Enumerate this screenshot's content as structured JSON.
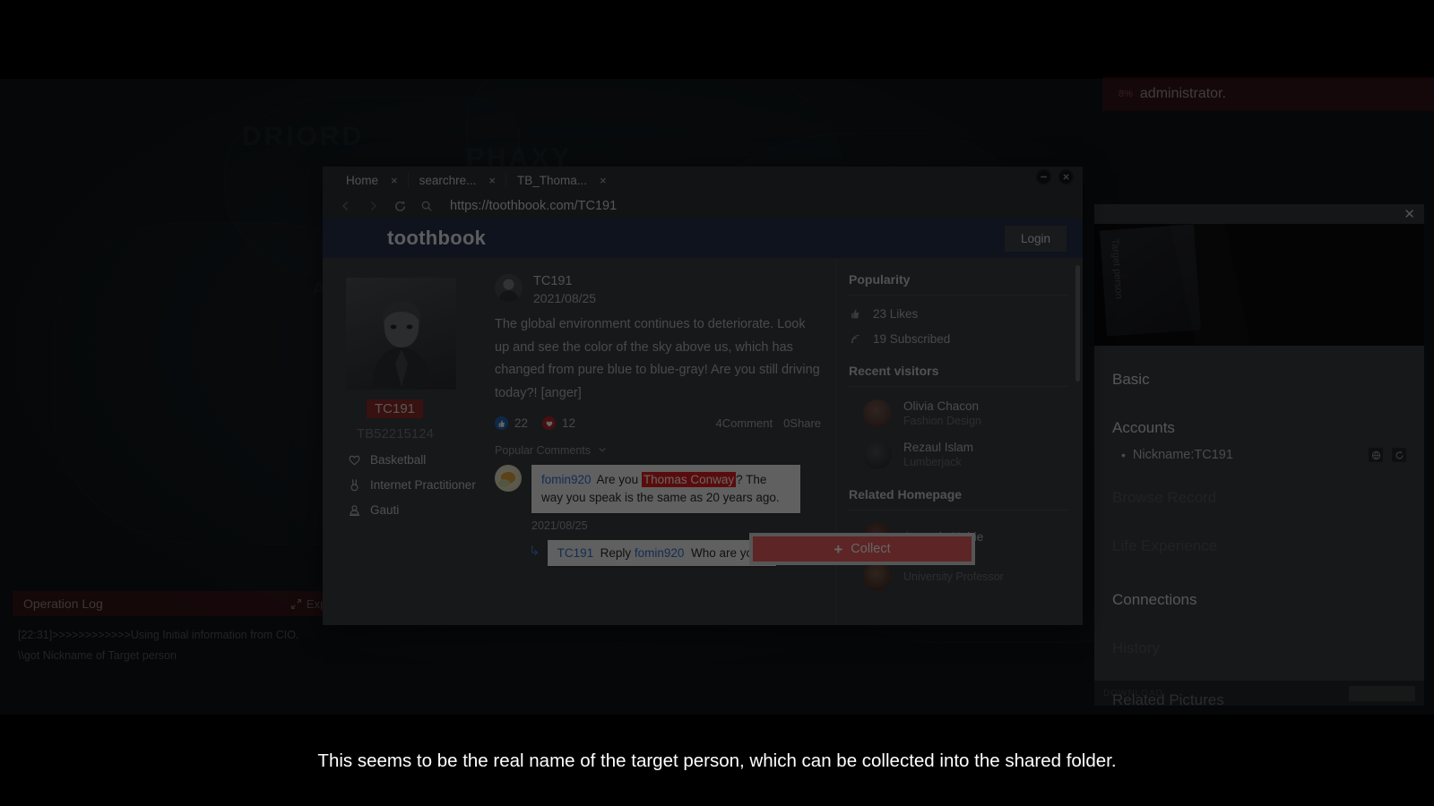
{
  "caption": "This seems to be the real name of the target person, which can be collected into the shared folder.",
  "admin_strip": {
    "percent": "8%",
    "text": "administrator."
  },
  "operation_log": {
    "title": "Operation Log",
    "expand_label": "Expand",
    "lines": [
      "[22:31]>>>>>>>>>>>>Using Initial information from CIO.",
      "\\\\got Nickname of Target person"
    ]
  },
  "background_map": {
    "labels": [
      "DRIORD",
      "PHAXY",
      "A"
    ]
  },
  "browser": {
    "tabs": [
      {
        "label": "Home",
        "close": "×"
      },
      {
        "label": "searchre...",
        "close": "×"
      },
      {
        "label": "TB_Thoma...",
        "close": "×"
      }
    ],
    "window_buttons": [
      "minimize-icon",
      "close-icon"
    ],
    "nav_icons": [
      "back-icon",
      "forward-icon",
      "reload-icon",
      "search-icon"
    ],
    "url": "https://toothbook.com/TC191"
  },
  "site": {
    "brand": "toothbook",
    "login_label": "Login",
    "profile": {
      "badge_name": "TC191",
      "user_id": "TB52215124",
      "meta": [
        {
          "icon": "heart-icon",
          "text": "Basketball"
        },
        {
          "icon": "medal-icon",
          "text": "Internet Practitioner"
        },
        {
          "icon": "location-person-icon",
          "text": "Gauti"
        }
      ]
    },
    "post": {
      "author": "TC191",
      "date": "2021/08/25",
      "text": "The global environment continues to deteriorate. Look up and see the color of the sky above us, which has changed from pure blue to blue-gray! Are you still driving today?! [anger]",
      "like_count": "22",
      "heart_count": "12",
      "comment_count": "4Comment",
      "share_count": "0Share"
    },
    "comments": {
      "section_label": "Popular Comments",
      "sort_icon": "chevron-down-icon",
      "items": [
        {
          "user": "fomin920",
          "text_before": "Are you ",
          "highlight": "Thomas Conway",
          "text_after": "? The way you speak is the same as 20 years ago.",
          "date": "2021/08/25"
        }
      ],
      "reply": {
        "user": "TC191",
        "verb": "Reply",
        "target": "fomin920",
        "text": "Who are you?"
      }
    },
    "right_sidebar": {
      "popularity": {
        "title": "Popularity",
        "rows": [
          {
            "icon": "thumbs-up-icon",
            "text": "23 Likes"
          },
          {
            "icon": "rss-icon",
            "text": "19 Subscribed"
          }
        ]
      },
      "recent_visitors": {
        "title": "Recent visitors",
        "people": [
          {
            "name": "Olivia Chacon",
            "job": "Fashion Design"
          },
          {
            "name": "Rezaul Islam",
            "job": "Lumberjack"
          }
        ]
      },
      "related_homepage": {
        "title": "Related Homepage",
        "people": [
          {
            "name": "Argentin Hebie",
            "job": ""
          },
          {
            "name": "",
            "job": "University Professor"
          }
        ]
      }
    }
  },
  "collect_popup": {
    "icon": "plus-icon",
    "label": "Collect"
  },
  "dossier": {
    "close_icon": "close-icon",
    "photo_label": "Target person",
    "sections": [
      {
        "title": "Basic",
        "active": true
      },
      {
        "title": "Accounts",
        "active": true
      },
      {
        "title": "Browse Record",
        "active": false
      },
      {
        "title": "Life Experience",
        "active": false
      },
      {
        "title": "Connections",
        "active": true
      },
      {
        "title": "History",
        "active": false
      },
      {
        "title": "Related Pictures",
        "active": true
      }
    ],
    "account_row": {
      "bullet": "•",
      "text": "Nickname:TC191",
      "icons": [
        "search-web-icon",
        "refresh-icon"
      ]
    },
    "footer": {
      "left_text": "DOWNLOAD",
      "button": ""
    }
  },
  "colors": {
    "accent_red": "#e85c5c",
    "highlight_red": "#e02020",
    "badge_red": "#8c2b2b",
    "site_header_blue": "#23304a",
    "link_blue": "#2f6fd0"
  }
}
